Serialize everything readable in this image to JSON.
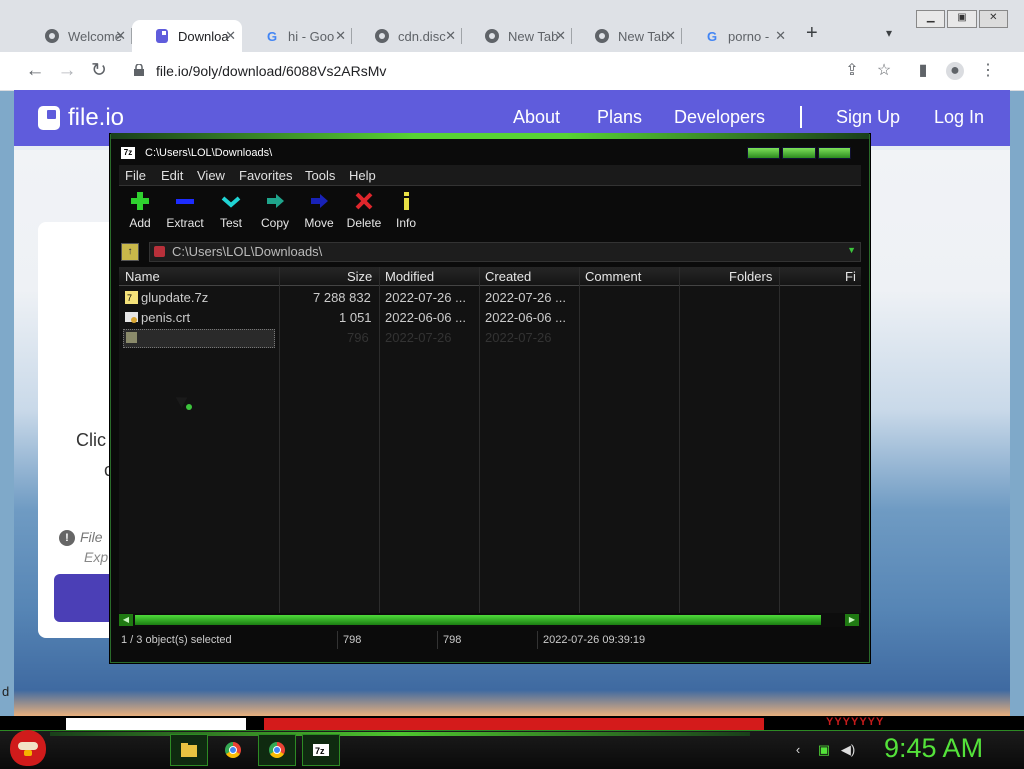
{
  "browser": {
    "tabs": [
      {
        "label": "Welcome",
        "icon": "globe-icon",
        "active": false
      },
      {
        "label": "Downloa",
        "icon": "fileio-icon",
        "active": true
      },
      {
        "label": "hi - Goo",
        "icon": "google-icon",
        "active": false
      },
      {
        "label": "cdn.disc",
        "icon": "globe-icon",
        "active": false
      },
      {
        "label": "New Tab",
        "icon": "chrome-icon",
        "active": false
      },
      {
        "label": "New Tab",
        "icon": "chrome-icon",
        "active": false
      },
      {
        "label": "porno -",
        "icon": "google-icon",
        "active": false
      }
    ],
    "tab_close": "✕",
    "new_tab": "+",
    "url": "file.io/9oly/download/6088Vs2ARsMv"
  },
  "site": {
    "logo_text": "file.io",
    "nav": [
      "About",
      "Plans",
      "Developers",
      "Sign Up",
      "Log In"
    ],
    "card_text1": "Clic",
    "card_text2": "c",
    "file_note1": "File",
    "file_note2": "Exp",
    "stray_text": "d"
  },
  "sevenzip": {
    "title": "C:\\Users\\LOL\\Downloads\\",
    "title_icon": "7z",
    "menu": [
      "File",
      "Edit",
      "View",
      "Favorites",
      "Tools",
      "Help"
    ],
    "tools": [
      {
        "label": "Add",
        "icon": "add-icon",
        "color": "#2fd12f"
      },
      {
        "label": "Extract",
        "icon": "extract-icon",
        "color": "#1d2cff"
      },
      {
        "label": "Test",
        "icon": "test-icon",
        "color": "#20d4d4"
      },
      {
        "label": "Copy",
        "icon": "copy-icon",
        "color": "#1fa58c"
      },
      {
        "label": "Move",
        "icon": "move-icon",
        "color": "#1822b8"
      },
      {
        "label": "Delete",
        "icon": "delete-icon",
        "color": "#e0262c"
      },
      {
        "label": "Info",
        "icon": "info-icon",
        "color": "#e8e045"
      }
    ],
    "path": "C:\\Users\\LOL\\Downloads\\",
    "columns": [
      "Name",
      "Size",
      "Modified",
      "Created",
      "Comment",
      "Folders",
      "Fi"
    ],
    "files": [
      {
        "name": "glupdate.7z",
        "size": "7 288 832",
        "modified": "2022-07-26 ...",
        "created": "2022-07-26 ...",
        "icon": "archive-icon"
      },
      {
        "name": "penis.crt",
        "size": "1 051",
        "modified": "2022-06-06 ...",
        "created": "2022-06-06 ...",
        "icon": "certificate-icon"
      },
      {
        "name": "",
        "size": "796",
        "modified": "2022-07-26",
        "created": "2022-07-26",
        "icon": "file-icon",
        "selected": true
      }
    ],
    "status": {
      "selection": "1 / 3 object(s) selected",
      "size": "798",
      "packed": "798",
      "date": "2022-07-26 09:39:19"
    }
  },
  "taskbar": {
    "clock": "9:45 AM",
    "desk_text": "YYYYYYY"
  },
  "colors": {
    "accent_green": "#54e23a",
    "fileio_purple": "#5f5cdc",
    "window_bg": "#0b0b0b"
  }
}
